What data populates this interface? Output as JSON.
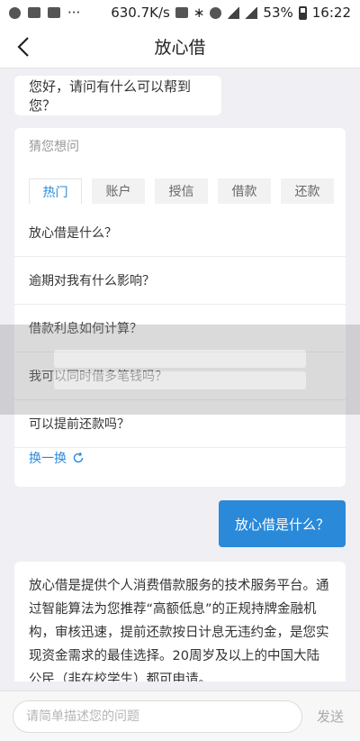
{
  "status_bar": {
    "speed": "630.7K/s",
    "battery": "53%",
    "time": "16:22"
  },
  "nav": {
    "title": "放心借"
  },
  "chat": {
    "greeting": "您好，请问有什么可以帮到您？",
    "faq": {
      "header": "猜您想问",
      "tabs": [
        {
          "label": "热门",
          "active": true
        },
        {
          "label": "账户",
          "active": false
        },
        {
          "label": "授信",
          "active": false
        },
        {
          "label": "借款",
          "active": false
        },
        {
          "label": "还款",
          "active": false
        }
      ],
      "questions": [
        "放心借是什么？",
        "逾期对我有什么影响？",
        "借款利息如何计算？",
        "我可以同时借多笔钱吗？",
        "可以提前还款吗？"
      ],
      "refresh_label": "换一换"
    },
    "user_message": "放心借是什么？",
    "answer": "放心借是提供个人消费借款服务的技术服务平台。通过智能算法为您推荐“高额低息”的正规持牌金融机构，审核迅速，提前还款按日计息无违约金，是您实现资金需求的最佳选择。20周岁及以上的中国大陆公民（非在校学生）都可申请。"
  },
  "input": {
    "placeholder": "请简单描述您的问题",
    "send_label": "发送"
  },
  "colors": {
    "accent": "#2a89d9",
    "background": "#efeff4"
  }
}
